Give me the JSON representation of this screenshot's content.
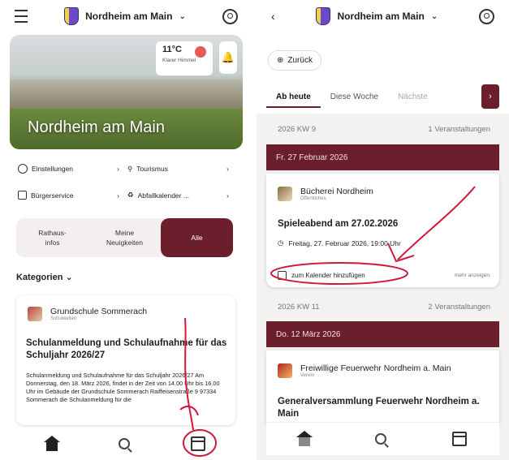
{
  "left": {
    "town": "Nordheim am Main",
    "weather": {
      "temp": "11°C",
      "desc": "Klarer Himmel"
    },
    "hero_title": "Nordheim am Main",
    "quick_links": [
      [
        "Einstellungen",
        "Tourismus"
      ],
      [
        "Bürgerservice",
        "Abfallkalender ..."
      ]
    ],
    "filter": [
      "Rathaus-\ninfos",
      "Meine\nNeuigkeiten",
      "Alle"
    ],
    "categories_label": "Kategorien",
    "post": {
      "org": "Grundschule Sommerach",
      "org_sub": "Schulwelten",
      "title": "Schulanmeldung und Schulaufnahme für das Schuljahr 2026/27",
      "body": "Schulanmeldung und Schulaufnahme für das Schuljahr 2026/27 Am Donnerstag, den 18. März 2026, findet in der Zeit von 14.00 Uhr bis 16.00 Uhr im Gebäude der Grundschule Sommerach Raiffeisenstraße 9 97334 Sommerach die Schulanmeldung für die"
    }
  },
  "right": {
    "town": "Nordheim am Main",
    "back": "Zurück",
    "tabs": [
      "Ab heute",
      "Diese Woche",
      "Nächste"
    ],
    "week1": {
      "kw": "2026 KW 9",
      "count": "1 Veranstaltungen"
    },
    "day1": "Fr. 27 Februar 2026",
    "event1": {
      "org": "Bücherei Nordheim",
      "org_sub": "Öffentliches",
      "title": "Spieleabend am 27.02.2026",
      "time": "Freitag, 27. Februar 2026, 19:00 Uhr",
      "add": "zum Kalender hinzufügen",
      "more": "mehr anzeigen"
    },
    "week2": {
      "kw": "2026 KW 11",
      "count": "2 Veranstaltungen"
    },
    "day2": "Do. 12 März 2026",
    "event2": {
      "org": "Freiwillige Feuerwehr Nordheim a. Main",
      "org_sub": "Verein",
      "title": "Generalversammlung Feuerwehr Nordheim a. Main"
    }
  },
  "icons": [
    "menu-icon",
    "crest-icon",
    "chevron-down-icon",
    "user-icon",
    "bell-icon",
    "gear-icon",
    "bike-icon",
    "building-icon",
    "recycle-icon",
    "home-icon",
    "search-icon",
    "calendar-icon",
    "clock-icon",
    "back-icon",
    "chevron-right-icon"
  ],
  "colors": {
    "brand": "#6b1f2d",
    "annotation": "#d2163c"
  }
}
